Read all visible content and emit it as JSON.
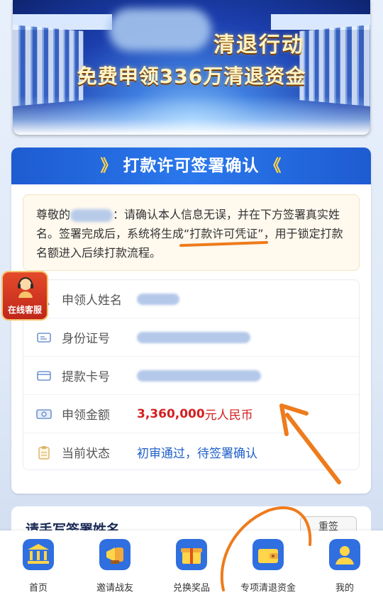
{
  "banner": {
    "title_line1": "清退行动",
    "title_line2": "免费申领336万清退资金"
  },
  "card": {
    "header_title": "打款许可签署确认",
    "chev_left": "》",
    "chev_right": "《",
    "notice": {
      "part1": "尊敬的",
      "part2": "：请确认本人信息无误，并在下方签署真实姓名。签署完成后，系统将生成",
      "highlight": "“打款许可凭证”",
      "part3": "，用于锁定打款名额进入后续打款流程。"
    },
    "rows": [
      {
        "label": "申领人姓名",
        "value": ""
      },
      {
        "label": "身份证号",
        "value": ""
      },
      {
        "label": "提款卡号",
        "value": ""
      },
      {
        "label": "申领金额",
        "value": "3,360,000",
        "unit": "元人民币"
      },
      {
        "label": "当前状态",
        "value": "初审通过，待签署确认"
      }
    ]
  },
  "signature_card": {
    "title": "请手写签署姓名",
    "reset_label": "重签"
  },
  "support": {
    "label": "在线客服"
  },
  "nav": {
    "items": [
      {
        "label": "首页",
        "icon": "bank-icon"
      },
      {
        "label": "邀请战友",
        "icon": "megaphone-icon"
      },
      {
        "label": "兑换奖品",
        "icon": "gift-icon"
      },
      {
        "label": "专项清退资金",
        "icon": "wallet-icon"
      },
      {
        "label": "我的",
        "icon": "user-icon"
      }
    ]
  },
  "colors": {
    "primary_blue": "#1e5bd1",
    "amount_red": "#d32020",
    "status_blue": "#1f5fc8",
    "annotation_orange": "#ee7b1c"
  }
}
